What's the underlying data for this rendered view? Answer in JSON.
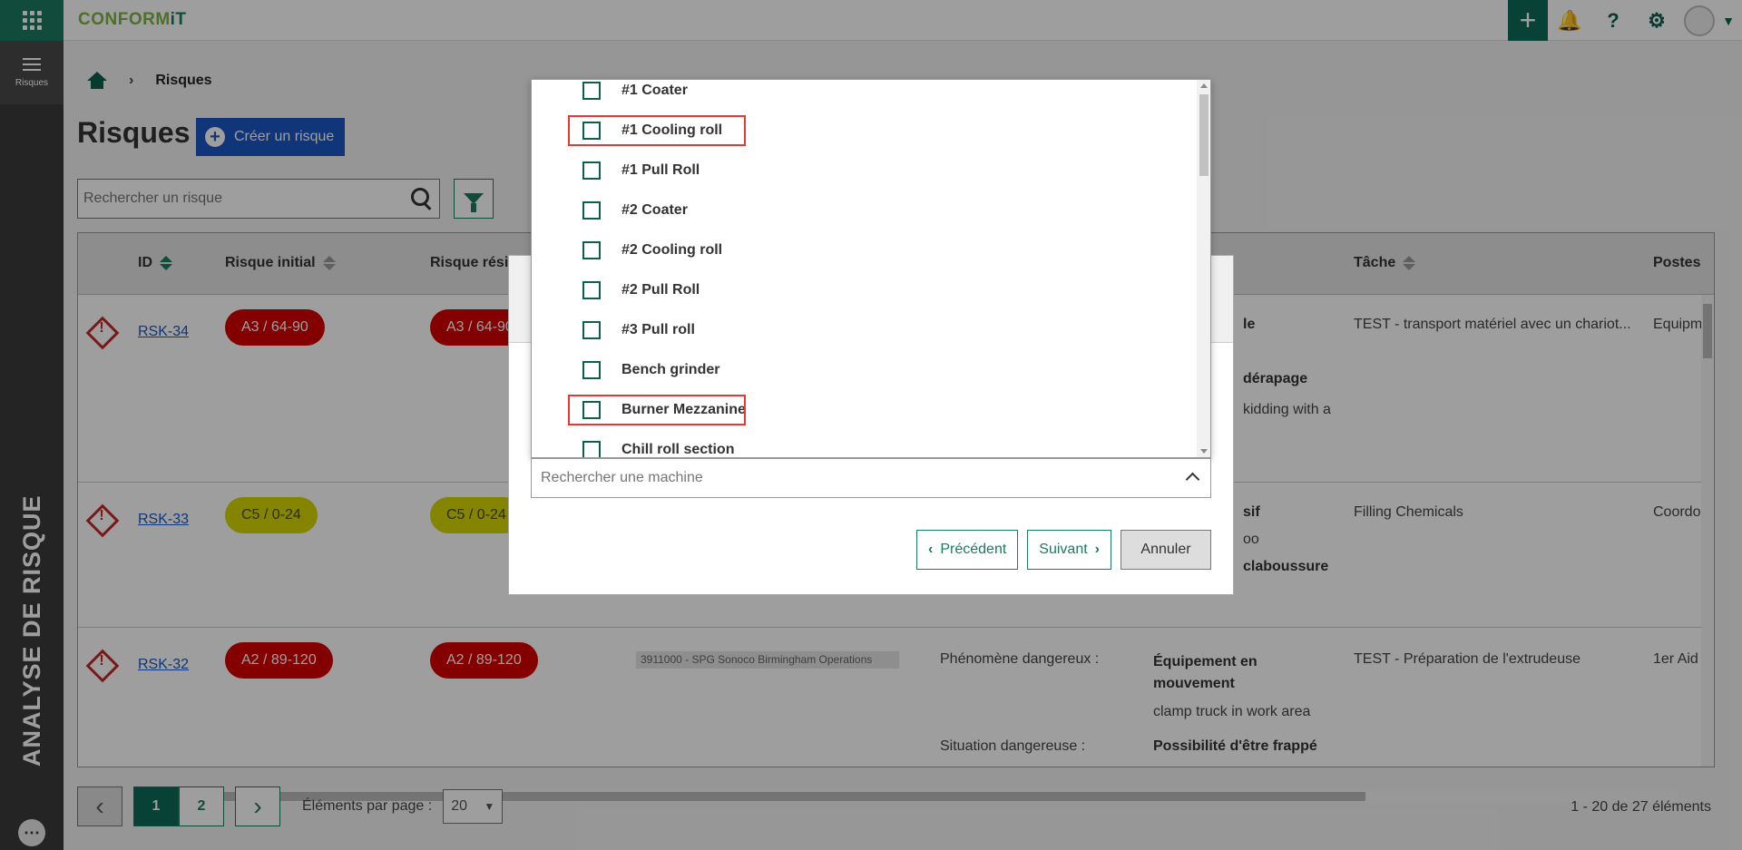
{
  "app": {
    "logo_main": "CONFORM",
    "logo_accent": "iT"
  },
  "topbar": {
    "plus": "+",
    "bell": "🔔",
    "help": "?",
    "gear": "⚙",
    "caret": "▼"
  },
  "sidebar": {
    "menu_label": "Risques",
    "vertical_title": "ANALYSE DE RISQUE",
    "info": "⋯"
  },
  "breadcrumb": {
    "sep": "›",
    "current": "Risques"
  },
  "page": {
    "title": "Risques",
    "create_button": "Créer un risque",
    "create_plus": "+"
  },
  "search": {
    "placeholder": "Rechercher un risque"
  },
  "table": {
    "headers": {
      "id": "ID",
      "initial": "Risque initial",
      "residual": "Risque résid",
      "tache": "Tâche",
      "postes": "Postes"
    },
    "rows": [
      {
        "id": "RSK-34",
        "initial": "A3 / 64-90",
        "residual": "A3 / 64-90",
        "initial_color": "red",
        "frag1": "le",
        "frag2": "dérapage",
        "frag3": "kidding with a",
        "tache": "TEST - transport matériel avec un chariot...",
        "poste": "Equipm"
      },
      {
        "id": "RSK-33",
        "initial": "C5 / 0-24",
        "residual": "C5 / 0-24",
        "initial_color": "yellow",
        "frag1": "sif",
        "frag2": "oo",
        "frag3": "claboussure",
        "tache": "Filling Chemicals",
        "poste": "Coordo"
      },
      {
        "id": "RSK-32",
        "initial": "A2 / 89-120",
        "residual": "A2 / 89-120",
        "initial_color": "red",
        "site": "3911000 - SPG Sonoco Birmingham Operations",
        "phenomene_label": "Phénomène dangereux :",
        "phenomene_value": "Équipement en mouvement",
        "description": "clamp truck in work area",
        "situation_label": "Situation dangereuse :",
        "situation_value": "Possibilité d'être frappé",
        "tache": "TEST - Préparation de l'extrudeuse",
        "poste": "1er Aid"
      }
    ]
  },
  "pager": {
    "prev": "‹",
    "next": "›",
    "pages": [
      "1",
      "2"
    ],
    "per_page_label": "Éléments par page :",
    "per_page_value": "20",
    "total": "1 - 20 de 27 éléments"
  },
  "dialog": {
    "prev": "Précédent",
    "next": "Suivant",
    "cancel": "Annuler",
    "chev_left": "‹",
    "chev_right": "›"
  },
  "machine_dropdown": {
    "items": [
      "#1 Coater",
      "#1 Cooling roll",
      "#1 Pull Roll",
      "#2 Coater",
      "#2 Cooling roll",
      "#2 Pull Roll",
      "#3 Pull roll",
      "Bench grinder",
      "Burner Mezzanine",
      "Chill roll section"
    ],
    "highlighted": [
      "#1 Cooling roll",
      "Burner Mezzanine"
    ],
    "search_placeholder": "Rechercher une machine"
  },
  "colors": {
    "brand_green": "#0d6b57",
    "accent_blue": "#1a56c4",
    "risk_red": "#d50000",
    "risk_yellow": "#d6d600",
    "highlight_red": "#e53935"
  }
}
